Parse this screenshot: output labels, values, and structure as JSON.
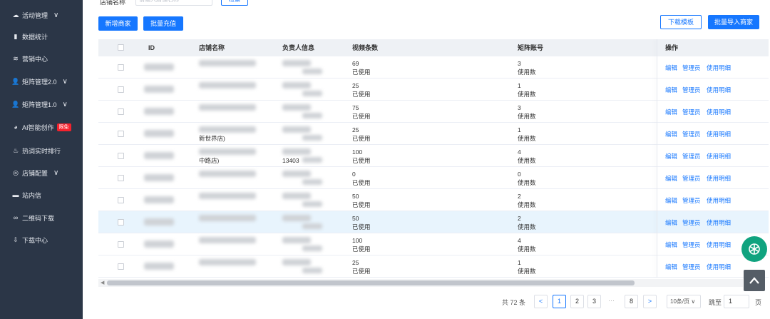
{
  "sidebar": {
    "items": [
      {
        "label": "活动管理",
        "icon": "cloud-icon",
        "chevron": "∨"
      },
      {
        "label": "数据统计",
        "icon": "bar-chart-icon"
      },
      {
        "label": "营销中心",
        "icon": "layers-icon"
      },
      {
        "label": "矩阵管理2.0",
        "icon": "user-icon",
        "chevron": "∨"
      },
      {
        "label": "矩阵管理1.0",
        "icon": "user-icon",
        "chevron": "∨"
      },
      {
        "label": "AI智能创作",
        "icon": "robot-icon",
        "badge": "限免"
      },
      {
        "label": "热词实时排行",
        "icon": "fire-icon"
      },
      {
        "label": "店铺配置",
        "icon": "settings-icon",
        "chevron": "∨"
      },
      {
        "label": "站内信",
        "icon": "message-icon"
      },
      {
        "label": "二维码下载",
        "icon": "link-icon"
      },
      {
        "label": "下载中心",
        "icon": "cloud-download-icon"
      }
    ]
  },
  "search": {
    "label": "店铺名称",
    "placeholder": "请输入店铺名称",
    "button": "检索"
  },
  "toolbar": {
    "add_merchant": "新增商家",
    "batch_recharge": "批量充值",
    "download_template": "下载模板",
    "batch_import": "批量导入商家"
  },
  "table": {
    "columns": {
      "id": "ID",
      "store_name": "店铺名称",
      "owner_info": "负责人信息",
      "video_count": "视频条数",
      "matrix_accounts": "矩阵账号",
      "actions": "操作"
    },
    "rows": [
      {
        "store_name": "",
        "owner": "",
        "video_count": "69",
        "video_used": "已使用",
        "matrix_count": "3",
        "matrix_used": "使用数"
      },
      {
        "store_name": "",
        "owner": "",
        "video_count": "25",
        "video_used": "已使用",
        "matrix_count": "1",
        "matrix_used": "使用数"
      },
      {
        "store_name": "",
        "owner": "",
        "video_count": "75",
        "video_used": "已使用",
        "matrix_count": "3",
        "matrix_used": "使用数"
      },
      {
        "store_name": "新世界店)",
        "owner": "",
        "video_count": "25",
        "video_used": "已使用",
        "matrix_count": "1",
        "matrix_used": "使用数"
      },
      {
        "store_name": "中路店)",
        "owner": "13403",
        "video_count": "100",
        "video_used": "已使用",
        "matrix_count": "4",
        "matrix_used": "使用数"
      },
      {
        "store_name": "",
        "owner": "",
        "video_count": "0",
        "video_used": "已使用",
        "matrix_count": "0",
        "matrix_used": "使用数"
      },
      {
        "store_name": "",
        "owner": "",
        "video_count": "50",
        "video_used": "已使用",
        "matrix_count": "2",
        "matrix_used": "使用数"
      },
      {
        "store_name": "",
        "owner": "",
        "video_count": "50",
        "video_used": "已使用",
        "matrix_count": "2",
        "matrix_used": "使用数"
      },
      {
        "store_name": "",
        "owner": "",
        "video_count": "100",
        "video_used": "已使用",
        "matrix_count": "4",
        "matrix_used": "使用数"
      },
      {
        "store_name": "",
        "owner": "",
        "video_count": "25",
        "video_used": "已使用",
        "matrix_count": "1",
        "matrix_used": "使用数"
      }
    ],
    "actions": {
      "edit": "编辑",
      "admin": "管理员",
      "usage": "使用明细"
    },
    "highlight_row": 7
  },
  "pagination": {
    "total": "共 72 条",
    "prev": "<",
    "pages": [
      "1",
      "2",
      "3"
    ],
    "ellipsis": "···",
    "last_page": "8",
    "next": ">",
    "page_size": "10条/页",
    "goto_label": "跳至",
    "goto_value": "1",
    "page_label": "页",
    "current": 1
  },
  "colors": {
    "sidebar_bg": "#2b3647",
    "primary": "#1677ff",
    "highlight_row": "#e8f4fd",
    "badge": "#f5222d"
  }
}
